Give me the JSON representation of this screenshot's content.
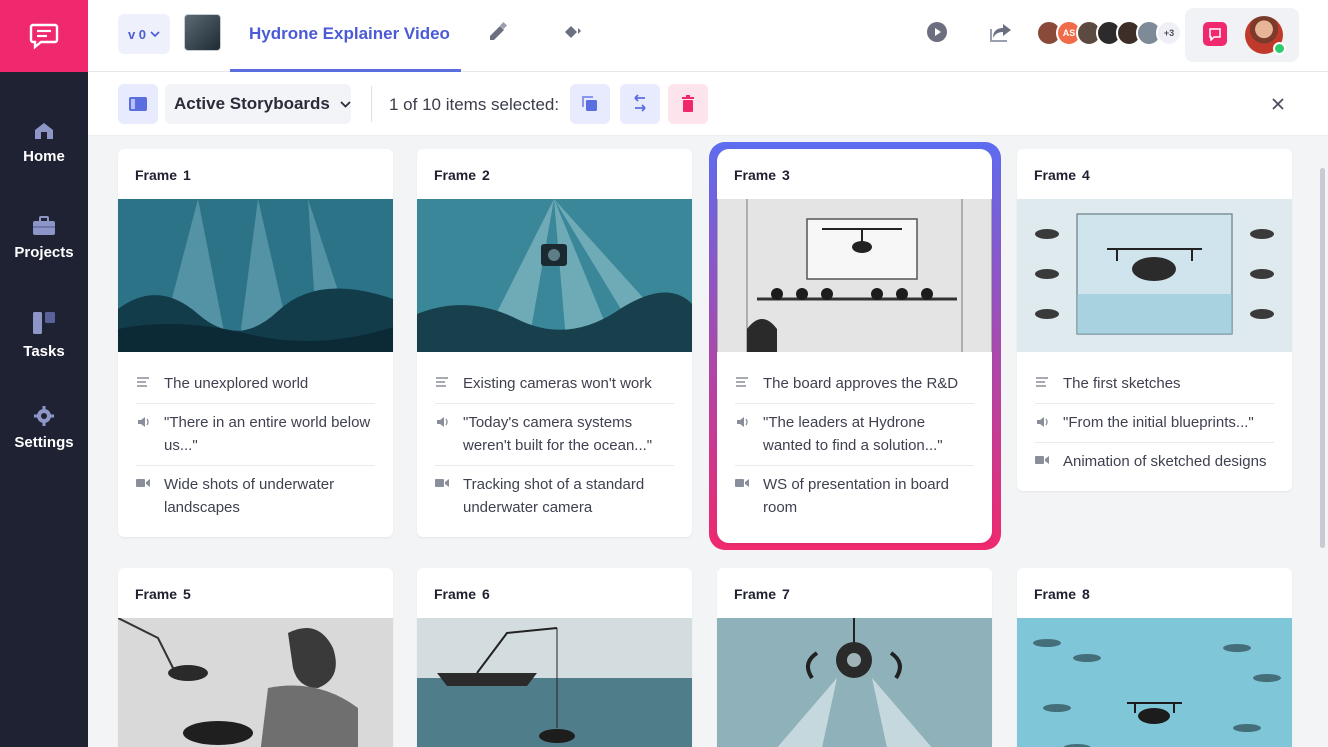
{
  "colors": {
    "brand": "#f0286e",
    "sidebar": "#1e2233",
    "accent": "#4b5bd6"
  },
  "sidebar": {
    "items": [
      {
        "label": "Home",
        "icon": "home-icon"
      },
      {
        "label": "Projects",
        "icon": "briefcase-icon"
      },
      {
        "label": "Tasks",
        "icon": "tasks-icon"
      },
      {
        "label": "Settings",
        "icon": "gear-icon"
      }
    ]
  },
  "header": {
    "version": "v 0",
    "project_title": "Hydrone Explainer Video",
    "extra_collaborators": "+3",
    "collaborator_initials": "AS"
  },
  "toolbar": {
    "view_label": "Active Storyboards",
    "selection_text": "1 of 10 items selected:"
  },
  "frames": [
    {
      "label": "Frame",
      "number": "1",
      "description": "The unexplored world",
      "dialogue": "\"There in an entire world below us...\"",
      "shot": "Wide shots of underwater landscapes"
    },
    {
      "label": "Frame",
      "number": "2",
      "description": "Existing cameras won't work",
      "dialogue": "\"Today's camera systems weren't built for the ocean...\"",
      "shot": "Tracking shot of a standard underwater camera"
    },
    {
      "label": "Frame",
      "number": "3",
      "description": "The board approves the R&D",
      "dialogue": "\"The leaders at Hydrone wanted to find a solution...\"",
      "shot": "WS of presentation in board room"
    },
    {
      "label": "Frame",
      "number": "4",
      "description": "The first sketches",
      "dialogue": "\"From the initial blueprints...\"",
      "shot": "Animation of sketched designs"
    },
    {
      "label": "Frame",
      "number": "5"
    },
    {
      "label": "Frame",
      "number": "6"
    },
    {
      "label": "Frame",
      "number": "7"
    },
    {
      "label": "Frame",
      "number": "8"
    }
  ]
}
